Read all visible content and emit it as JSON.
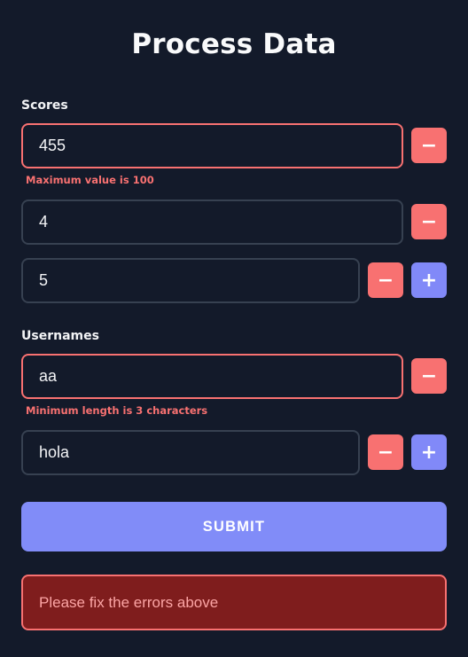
{
  "form": {
    "title": "Process Data",
    "scores": {
      "label": "Scores",
      "items": [
        {
          "value": "455",
          "error": "Maximum value is 100"
        },
        {
          "value": "4"
        },
        {
          "value": "5"
        }
      ]
    },
    "usernames": {
      "label": "Usernames",
      "items": [
        {
          "value": "aa",
          "error": "Minimum length is 3 characters"
        },
        {
          "value": "hola"
        }
      ]
    },
    "remove_symbol": "−",
    "add_symbol": "+",
    "submit_label": "SUBMIT",
    "error_alert": "Please fix the errors above"
  },
  "colors": {
    "background": "#131a2a",
    "error": "#f87171",
    "accent": "#818cf8",
    "alert_bg": "#7f1d1d"
  }
}
